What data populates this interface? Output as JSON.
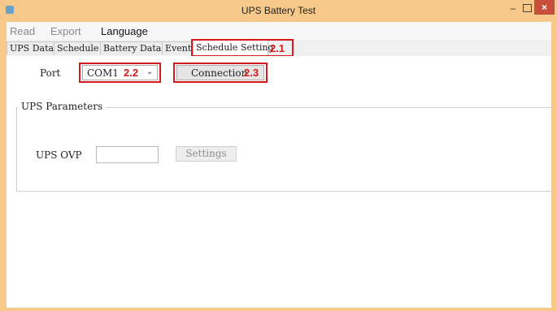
{
  "window": {
    "title": "UPS Battery Test",
    "minimize_glyph": "–",
    "close_glyph": "×"
  },
  "menu": {
    "items": [
      "Read",
      "Export",
      "Language"
    ]
  },
  "tabs": {
    "items": [
      "UPS Data",
      "Schedule",
      "Battery Data",
      "Event",
      "Schedule Setting"
    ],
    "active": "Schedule Setting"
  },
  "annotations": {
    "tab": "2.1",
    "port": "2.2",
    "connection": "2.3"
  },
  "form": {
    "port_label": "Port",
    "port_value": "COM1",
    "connection_label": "Connection"
  },
  "group": {
    "title": "UPS Parameters",
    "ovp_label": "UPS OVP",
    "ovp_value": "",
    "settings_label": "Settings"
  },
  "colors": {
    "titlebar": "#f6c98a",
    "annotation": "#d7191c",
    "close_button": "#c7503c"
  }
}
